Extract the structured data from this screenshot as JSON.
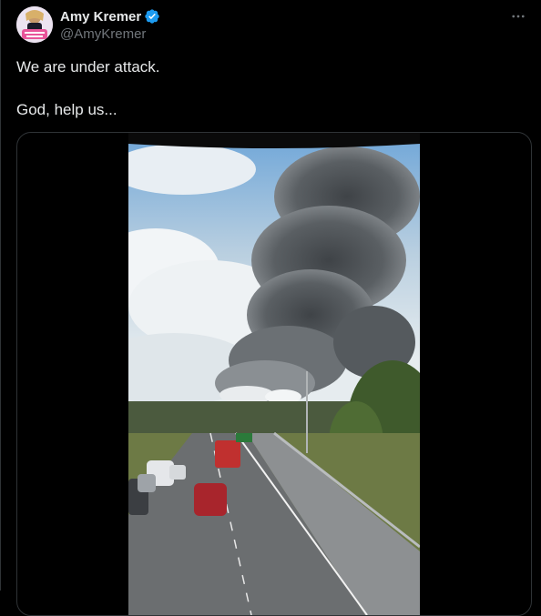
{
  "author": {
    "display_name": "Amy Kremer",
    "handle": "@AmyKremer",
    "verified": true,
    "avatar_icon": "profile-avatar"
  },
  "tweet": {
    "lines": [
      "We are under attack.",
      "God, help us..."
    ]
  },
  "media": {
    "type": "video",
    "icon": "video-thumbnail"
  },
  "colors": {
    "background": "#000000",
    "text": "#e7e9ea",
    "secondary_text": "#71767b",
    "verified_blue": "#1d9bf0",
    "border": "#2f3336"
  }
}
